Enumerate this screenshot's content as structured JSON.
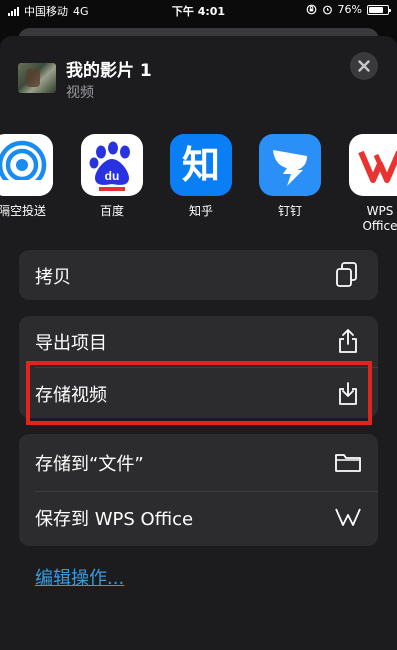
{
  "status_bar": {
    "carrier": "中国移动",
    "network": "4G",
    "time": "下午 4:01",
    "battery_text": "76%",
    "battery_level": 0.76
  },
  "share_sheet": {
    "title": "我的影片 1",
    "subtitle": "视频",
    "close_icon": "close-icon"
  },
  "apps": [
    {
      "label": "隔空投送",
      "icon": "airdrop-icon",
      "color": "#ffffff"
    },
    {
      "label": "百度",
      "icon": "baidu-icon",
      "color": "#ffffff"
    },
    {
      "label": "知乎",
      "icon": "zhihu-icon",
      "color": "#0a7ff5",
      "glyph": "知"
    },
    {
      "label": "钉钉",
      "icon": "dingtalk-icon",
      "color": "#2a8ff6"
    },
    {
      "label": "WPS",
      "label2": "Office",
      "icon": "wps-office-icon",
      "color": "#ffffff"
    }
  ],
  "actions": {
    "copy": "拷贝",
    "export_project": "导出项目",
    "save_video": "存储视频",
    "save_to_files": "存储到“文件”",
    "save_to_wps": "保存到 WPS Office"
  },
  "edit_actions": "编辑操作...",
  "colors": {
    "highlight": "#e0261c",
    "link": "#3a9bdc",
    "sheet": "#1c1c1e",
    "group": "#2c2c2e"
  }
}
